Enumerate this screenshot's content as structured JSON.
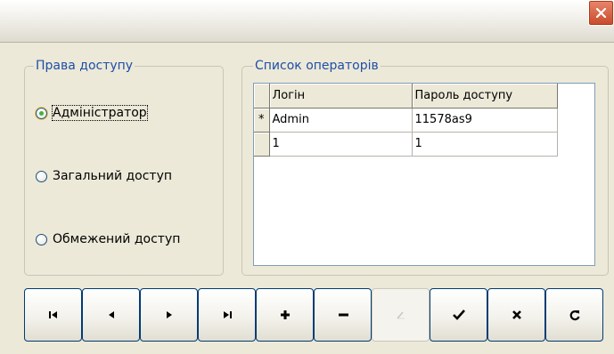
{
  "window": {
    "title": "",
    "close_icon": "close-icon"
  },
  "rights": {
    "legend": "Права доступу",
    "options": [
      {
        "label": "Адміністратор",
        "checked": true
      },
      {
        "label": "Загальний доступ",
        "checked": false
      },
      {
        "label": "Обмежений доступ",
        "checked": false
      }
    ]
  },
  "operators": {
    "legend": "Список операторів",
    "columns": [
      "Логін",
      "Пароль доступу"
    ],
    "rows": [
      {
        "indicator": "*",
        "login": "Admin",
        "password": "11578as9"
      },
      {
        "indicator": "",
        "login": "1",
        "password": "1"
      }
    ]
  },
  "navigator": {
    "buttons": [
      {
        "icon": "first-record-icon",
        "enabled": true
      },
      {
        "icon": "prior-record-icon",
        "enabled": true
      },
      {
        "icon": "next-record-icon",
        "enabled": true
      },
      {
        "icon": "last-record-icon",
        "enabled": true
      },
      {
        "icon": "insert-record-icon",
        "enabled": true
      },
      {
        "icon": "delete-record-icon",
        "enabled": true
      },
      {
        "icon": "edit-record-icon",
        "enabled": false
      },
      {
        "icon": "post-record-icon",
        "enabled": true
      },
      {
        "icon": "cancel-record-icon",
        "enabled": true
      },
      {
        "icon": "refresh-icon",
        "enabled": true
      }
    ]
  },
  "colors": {
    "legend_text": "#1f4ea8",
    "radio_checked": "#3fb33f",
    "close_button": "#c74a2a"
  }
}
